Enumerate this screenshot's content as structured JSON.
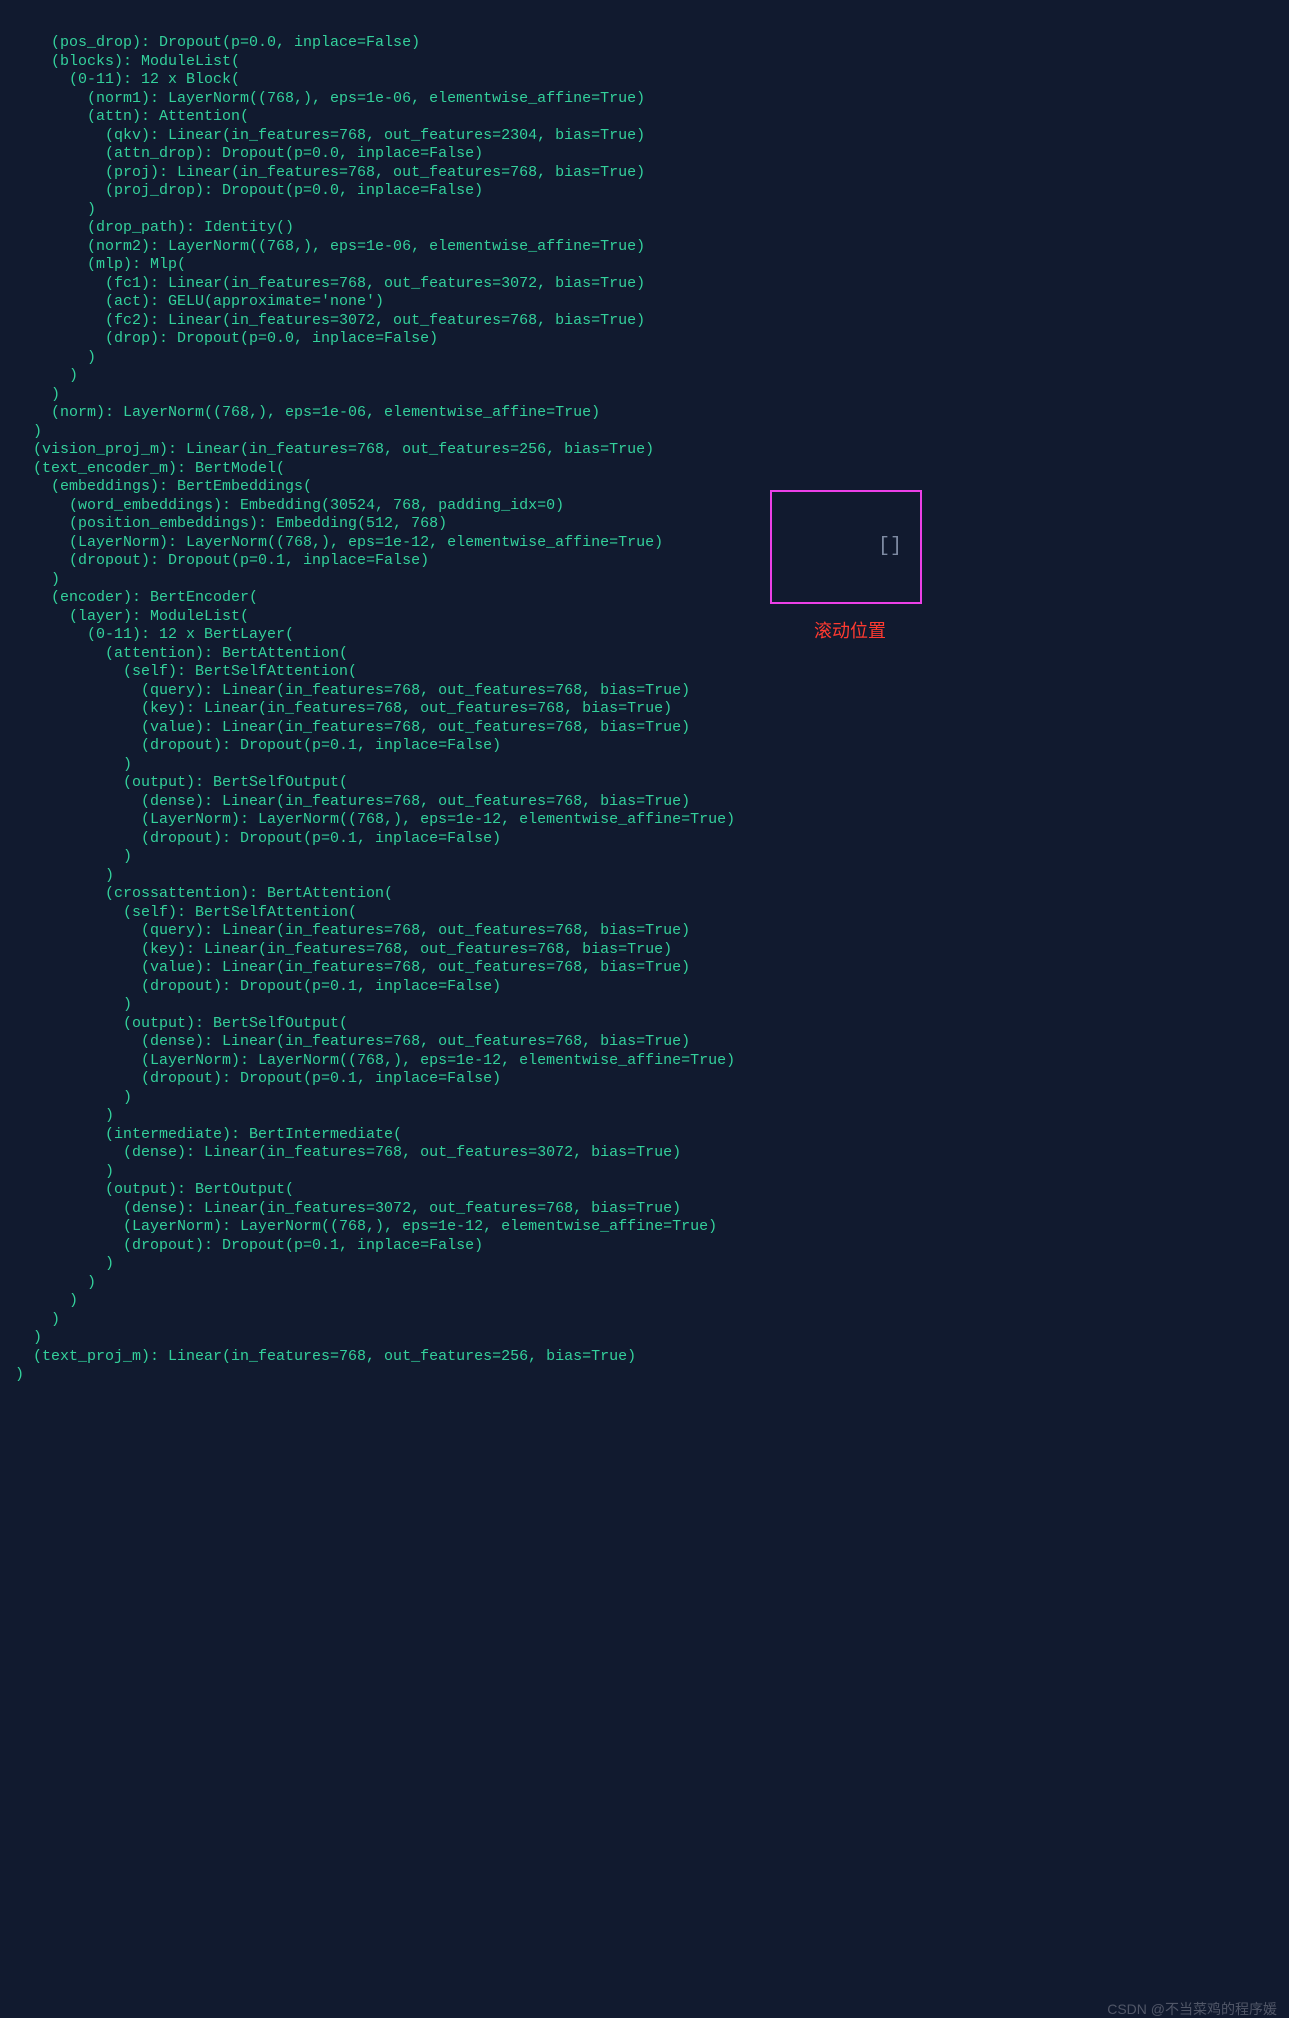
{
  "code_text": "    (pos_drop): Dropout(p=0.0, inplace=False)\n    (blocks): ModuleList(\n      (0-11): 12 x Block(\n        (norm1): LayerNorm((768,), eps=1e-06, elementwise_affine=True)\n        (attn): Attention(\n          (qkv): Linear(in_features=768, out_features=2304, bias=True)\n          (attn_drop): Dropout(p=0.0, inplace=False)\n          (proj): Linear(in_features=768, out_features=768, bias=True)\n          (proj_drop): Dropout(p=0.0, inplace=False)\n        )\n        (drop_path): Identity()\n        (norm2): LayerNorm((768,), eps=1e-06, elementwise_affine=True)\n        (mlp): Mlp(\n          (fc1): Linear(in_features=768, out_features=3072, bias=True)\n          (act): GELU(approximate='none')\n          (fc2): Linear(in_features=3072, out_features=768, bias=True)\n          (drop): Dropout(p=0.0, inplace=False)\n        )\n      )\n    )\n    (norm): LayerNorm((768,), eps=1e-06, elementwise_affine=True)\n  )\n  (vision_proj_m): Linear(in_features=768, out_features=256, bias=True)\n  (text_encoder_m): BertModel(\n    (embeddings): BertEmbeddings(\n      (word_embeddings): Embedding(30524, 768, padding_idx=0)\n      (position_embeddings): Embedding(512, 768)\n      (LayerNorm): LayerNorm((768,), eps=1e-12, elementwise_affine=True)\n      (dropout): Dropout(p=0.1, inplace=False)\n    )\n    (encoder): BertEncoder(\n      (layer): ModuleList(\n        (0-11): 12 x BertLayer(\n          (attention): BertAttention(\n            (self): BertSelfAttention(\n              (query): Linear(in_features=768, out_features=768, bias=True)\n              (key): Linear(in_features=768, out_features=768, bias=True)\n              (value): Linear(in_features=768, out_features=768, bias=True)\n              (dropout): Dropout(p=0.1, inplace=False)\n            )\n            (output): BertSelfOutput(\n              (dense): Linear(in_features=768, out_features=768, bias=True)\n              (LayerNorm): LayerNorm((768,), eps=1e-12, elementwise_affine=True)\n              (dropout): Dropout(p=0.1, inplace=False)\n            )\n          )\n          (crossattention): BertAttention(\n            (self): BertSelfAttention(\n              (query): Linear(in_features=768, out_features=768, bias=True)\n              (key): Linear(in_features=768, out_features=768, bias=True)\n              (value): Linear(in_features=768, out_features=768, bias=True)\n              (dropout): Dropout(p=0.1, inplace=False)\n            )\n            (output): BertSelfOutput(\n              (dense): Linear(in_features=768, out_features=768, bias=True)\n              (LayerNorm): LayerNorm((768,), eps=1e-12, elementwise_affine=True)\n              (dropout): Dropout(p=0.1, inplace=False)\n            )\n          )\n          (intermediate): BertIntermediate(\n            (dense): Linear(in_features=768, out_features=3072, bias=True)\n          )\n          (output): BertOutput(\n            (dense): Linear(in_features=3072, out_features=768, bias=True)\n            (LayerNorm): LayerNorm((768,), eps=1e-12, elementwise_affine=True)\n            (dropout): Dropout(p=0.1, inplace=False)\n          )\n        )\n      )\n    )\n  )\n  (text_proj_m): Linear(in_features=768, out_features=256, bias=True)\n)",
  "overlay": {
    "glyph": "[]",
    "caption": "滚动位置"
  },
  "watermark": "CSDN @不当菜鸡的程序媛"
}
